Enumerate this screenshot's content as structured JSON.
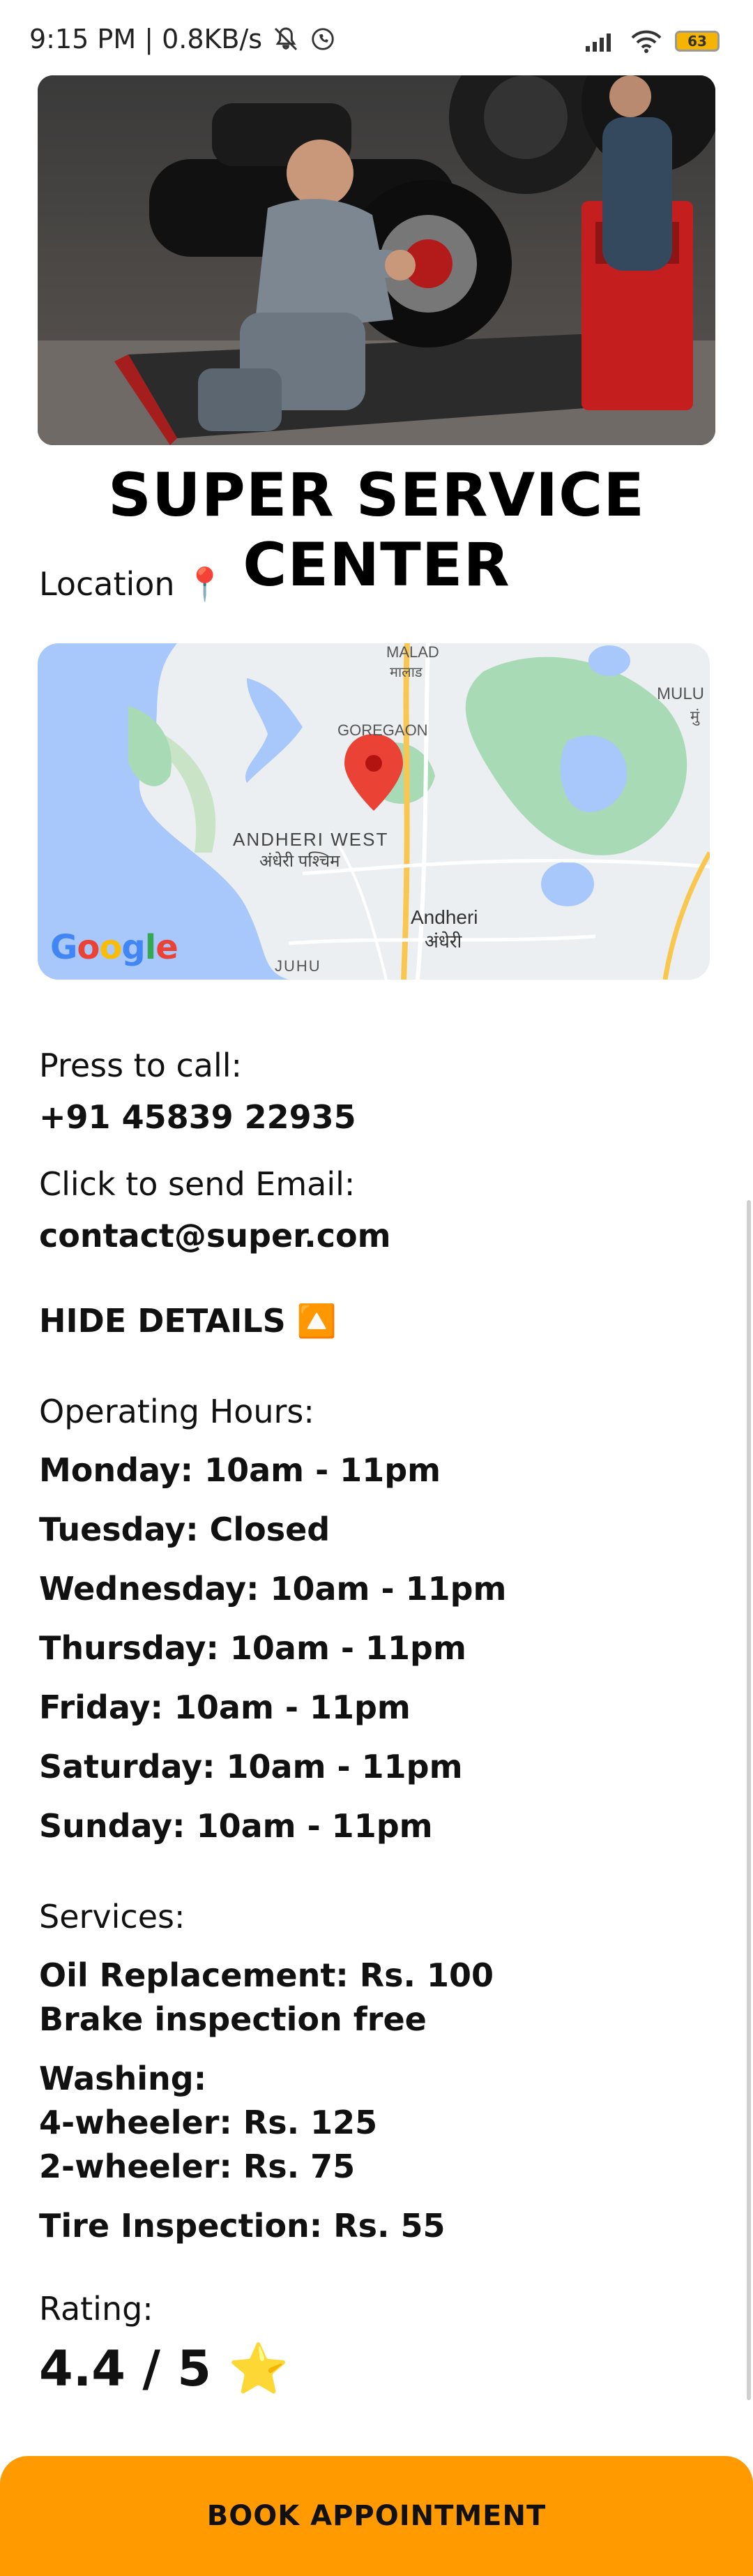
{
  "status": {
    "time_speed": "9:15 PM | 0.8KB/s",
    "battery": "63"
  },
  "service": {
    "name": "SUPER SERVICE CENTER",
    "location_label": "Location 📍"
  },
  "map": {
    "places": {
      "malad": "MALAD",
      "malad_dev": "मालाड",
      "goregaon": "GOREGAON",
      "mulund": "MULU",
      "mulund_dev": "मुं",
      "andheri_west": "ANDHERI WEST",
      "andheri_west_dev": "अंधेरी पश्चिम",
      "andheri": "Andheri",
      "andheri_dev": "अंधेरी",
      "juhu": "JUHU"
    },
    "provider_logo": "Google"
  },
  "contact": {
    "call_label": "Press to call:",
    "phone": "+91 45839 22935",
    "email_label": "Click to send Email:",
    "email": "contact@super.com"
  },
  "details": {
    "toggle_label": "HIDE DETAILS 🔼",
    "hours_label": "Operating Hours:",
    "hours": [
      "Monday: 10am - 11pm",
      "Tuesday: Closed",
      "Wednesday: 10am - 11pm",
      "Thursday: 10am - 11pm",
      "Friday: 10am - 11pm",
      "Saturday: 10am - 11pm",
      "Sunday: 10am - 11pm"
    ],
    "services_label": "Services:",
    "services": {
      "oil": "Oil Replacement: Rs. 100",
      "brake": "Brake inspection free",
      "washing": "Washing:",
      "four_wheeler": "4-wheeler: Rs. 125",
      "two_wheeler": "2-wheeler: Rs. 75",
      "tire": "Tire Inspection: Rs. 55"
    },
    "rating_label": "Rating:",
    "rating_value": "4.4 / 5 ⭐"
  },
  "actions": {
    "book_label": "BOOK APPOINTMENT"
  },
  "colors": {
    "accent": "#ff9b00",
    "map_water": "#a8c7fa",
    "map_park": "#a8dab5",
    "map_pin": "#ea4335"
  }
}
